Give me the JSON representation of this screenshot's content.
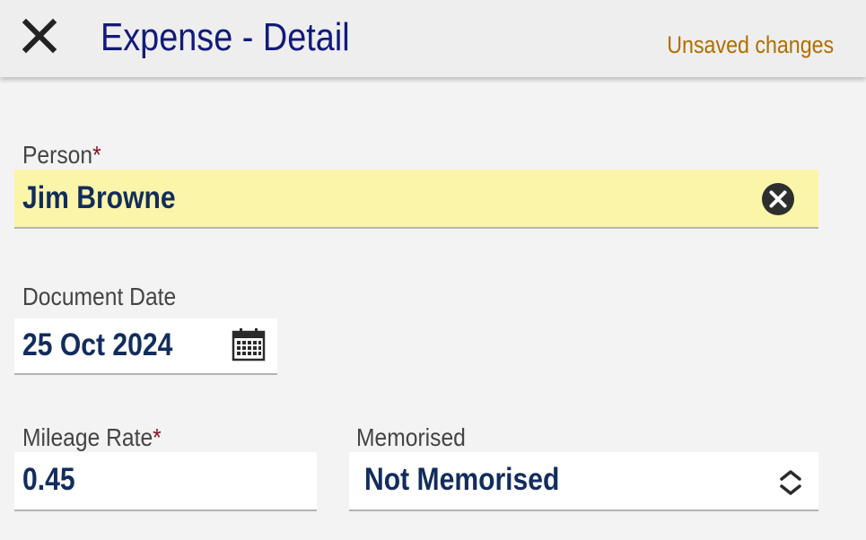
{
  "header": {
    "title": "Expense - Detail",
    "status": "Unsaved changes",
    "close_icon": "close-icon"
  },
  "form": {
    "person": {
      "label": "Person",
      "required_mark": "*",
      "value": "Jim Browne",
      "clear_icon": "clear-circle-icon"
    },
    "document_date": {
      "label": "Document Date",
      "value": "25 Oct 2024",
      "icon": "calendar-icon"
    },
    "mileage_rate": {
      "label": "Mileage Rate",
      "required_mark": "*",
      "value": "0.45"
    },
    "memorised": {
      "label": "Memorised",
      "selected": "Not Memorised",
      "icon": "sort-chevrons-icon"
    }
  },
  "colors": {
    "title": "#121a7a",
    "status": "#b06e00",
    "value_text": "#122d5c",
    "required": "#8a1020",
    "highlight": "#fbf5a9"
  }
}
